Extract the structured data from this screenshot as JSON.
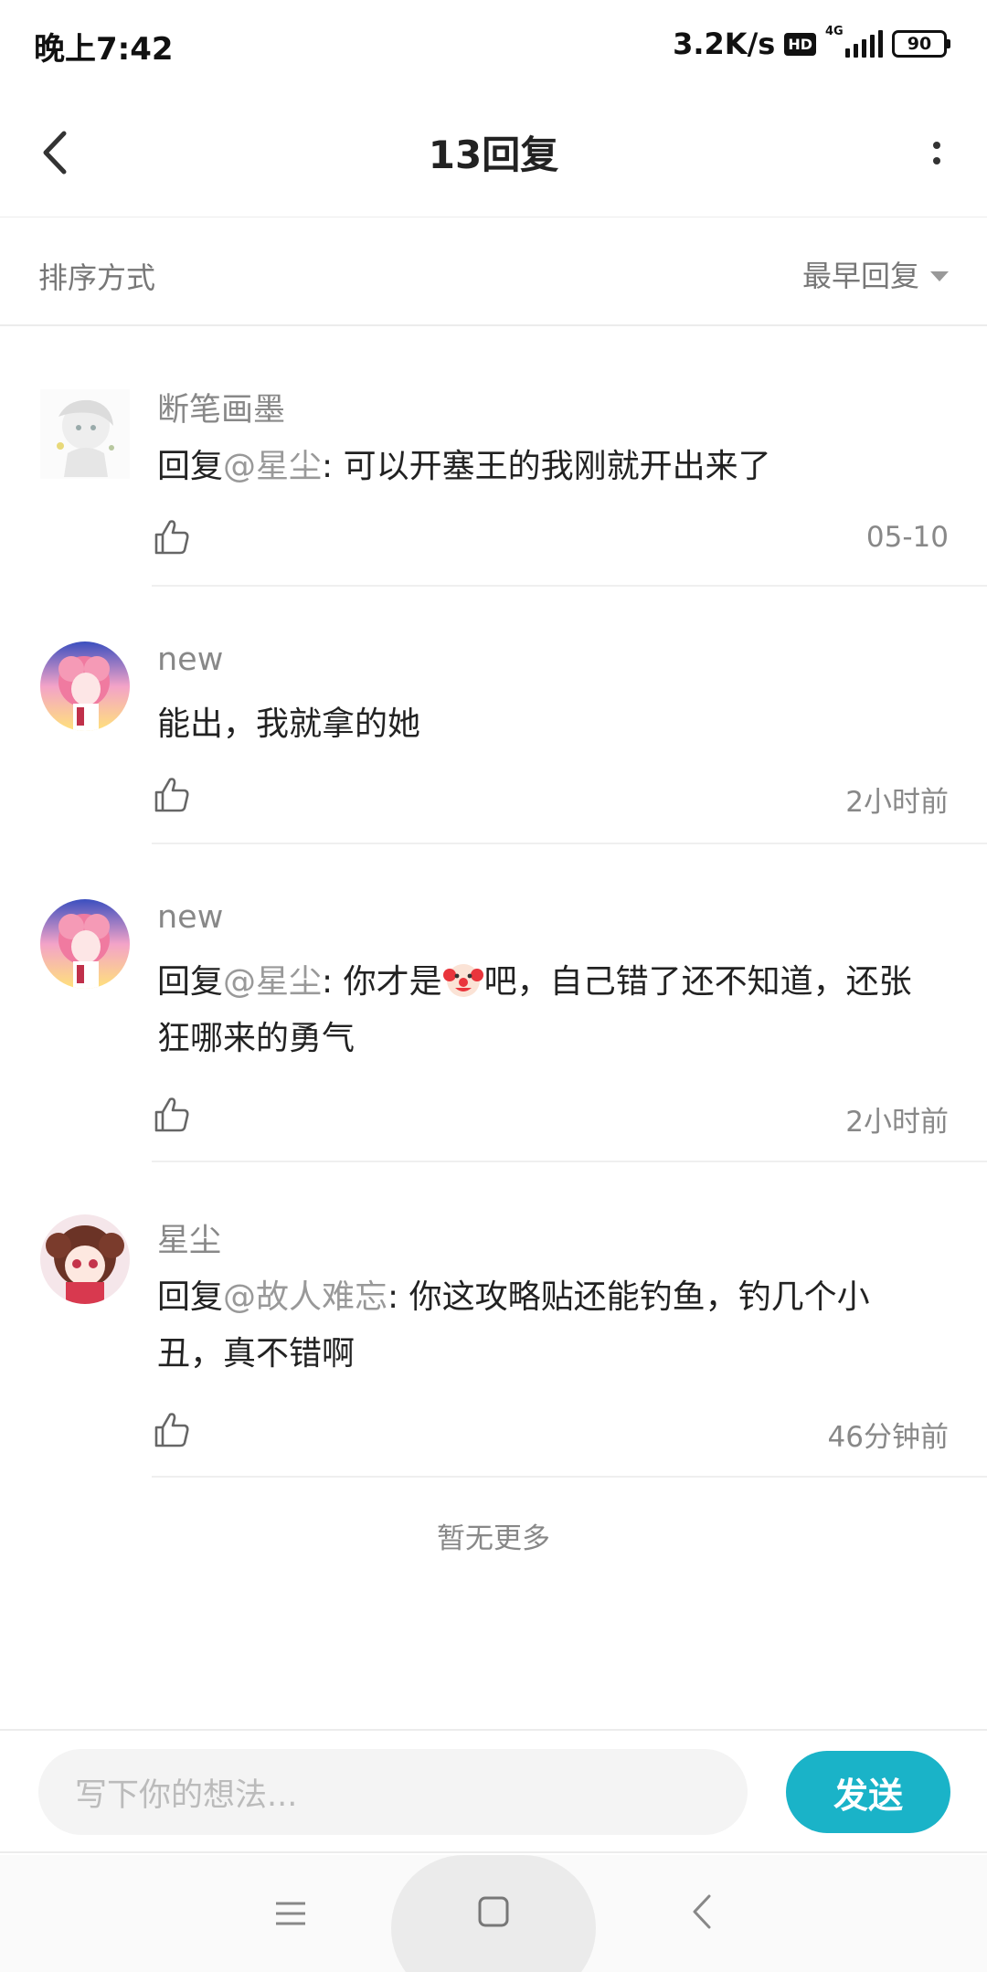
{
  "status_bar": {
    "time": "晚上7:42",
    "net_speed": "3.2K/s",
    "hd": "HD",
    "network": "4G",
    "battery": "90"
  },
  "header": {
    "title": "13回复"
  },
  "sort": {
    "label": "排序方式",
    "selected": "最早回复"
  },
  "replies": [
    {
      "name": "断笔画墨",
      "prefix": "回复",
      "mention": "@星尘",
      "text": ": 可以开塞王的我刚就开出来了",
      "time": "05-10"
    },
    {
      "name": "new",
      "prefix": "",
      "mention": "",
      "text": "能出，我就拿的她",
      "time": "2小时前"
    },
    {
      "name": "new",
      "prefix": "回复",
      "mention": "@星尘",
      "text_before_emoji": ": 你才是",
      "emoji": "clown",
      "text_after_emoji": "吧，自己错了还不知道，还张狂哪来的勇气",
      "time": "2小时前"
    },
    {
      "name": "星尘",
      "prefix": "回复",
      "mention": "@故人难忘",
      "text": ": 你这攻略贴还能钓鱼，钓几个小丑，真不错啊",
      "time": "46分钟前"
    }
  ],
  "footer_note": "暂无更多",
  "composer": {
    "placeholder": "写下你的想法...",
    "send_label": "发送"
  },
  "colors": {
    "accent": "#1ab3c8",
    "muted_text": "#888888",
    "mention": "#999999"
  },
  "icons": [
    "back-arrow-icon",
    "more-vertical-icon",
    "caret-down-icon",
    "thumbs-up-icon",
    "menu-icon",
    "home-icon",
    "nav-back-icon"
  ]
}
